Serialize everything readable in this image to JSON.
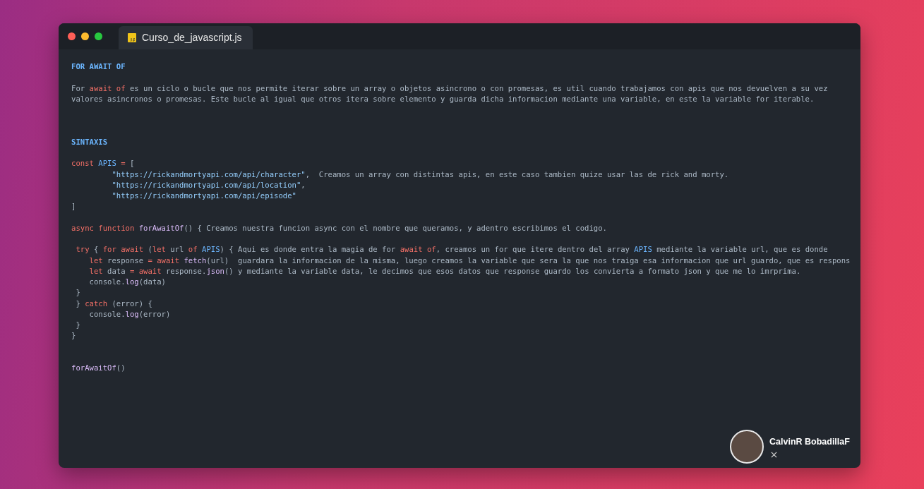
{
  "window": {
    "tabs": [
      {
        "label": "Curso_de_javascript.js",
        "selected": true
      }
    ]
  },
  "code": {
    "lines": [
      {
        "kind": "code",
        "tokens": [
          {
            "kind": "heading",
            "text": "FOR AWAIT OF"
          }
        ]
      },
      {
        "kind": "blank"
      },
      {
        "kind": "code",
        "tokens": [
          {
            "kind": "text",
            "text": "For "
          },
          {
            "kind": "keyword",
            "text": "await of"
          },
          {
            "kind": "text",
            "text": " es un ciclo o bucle que nos permite iterar sobre un array o objetos asincrono o con promesas, es util cuando trabajamos con apis que nos devuelven a su vez"
          }
        ]
      },
      {
        "kind": "code",
        "tokens": [
          {
            "kind": "text",
            "text": "valores asincronos o promesas. Este bucle al igual que otros itera sobre elemento y guarda dicha informacion mediante una variable, en este la variable for iterable."
          }
        ]
      },
      {
        "kind": "blank"
      },
      {
        "kind": "blank"
      },
      {
        "kind": "blank"
      },
      {
        "kind": "code",
        "tokens": [
          {
            "kind": "heading",
            "text": "SINTAXIS"
          }
        ]
      },
      {
        "kind": "blank"
      },
      {
        "kind": "code",
        "tokens": [
          {
            "kind": "keyword",
            "text": "const "
          },
          {
            "kind": "name",
            "text": "APIS "
          },
          {
            "kind": "keyword",
            "text": "="
          },
          {
            "kind": "text",
            "text": " ["
          }
        ]
      },
      {
        "kind": "code",
        "tokens": [
          {
            "kind": "string",
            "text": "         \"https://rickandmortyapi.com/api/character\""
          },
          {
            "kind": "text",
            "text": ",  Creamos un array con distintas apis, en este caso tambien quize usar las de rick and morty."
          }
        ]
      },
      {
        "kind": "code",
        "tokens": [
          {
            "kind": "string",
            "text": "         \"https://rickandmortyapi.com/api/location\""
          },
          {
            "kind": "text",
            "text": ","
          }
        ]
      },
      {
        "kind": "code",
        "tokens": [
          {
            "kind": "string",
            "text": "         \"https://rickandmortyapi.com/api/episode\""
          }
        ]
      },
      {
        "kind": "code",
        "tokens": [
          {
            "kind": "text",
            "text": "]"
          }
        ]
      },
      {
        "kind": "blank"
      },
      {
        "kind": "code",
        "tokens": [
          {
            "kind": "keyword",
            "text": "async function "
          },
          {
            "kind": "func",
            "text": "forAwaitOf"
          },
          {
            "kind": "text",
            "text": "() { Creamos nuestra funcion async con el nombre que queramos, y adentro escribimos el codigo."
          }
        ]
      },
      {
        "kind": "blank"
      },
      {
        "kind": "code",
        "tokens": [
          {
            "kind": "keyword",
            "text": " try"
          },
          {
            "kind": "text",
            "text": " { "
          },
          {
            "kind": "keyword",
            "text": "for await"
          },
          {
            "kind": "text",
            "text": " ("
          },
          {
            "kind": "keyword",
            "text": "let"
          },
          {
            "kind": "text",
            "text": " url "
          },
          {
            "kind": "keyword",
            "text": "of "
          },
          {
            "kind": "name",
            "text": "APIS"
          },
          {
            "kind": "text",
            "text": ") { Aqui es donde entra la magia de for "
          },
          {
            "kind": "keyword",
            "text": "await of"
          },
          {
            "kind": "text",
            "text": ", creamos un for que itere dentro del array "
          },
          {
            "kind": "name",
            "text": "APIS"
          },
          {
            "kind": "text",
            "text": " mediante la variable url, que es donde"
          }
        ]
      },
      {
        "kind": "code",
        "tokens": [
          {
            "kind": "keyword",
            "text": "    let"
          },
          {
            "kind": "text",
            "text": " response "
          },
          {
            "kind": "keyword",
            "text": "= await "
          },
          {
            "kind": "func",
            "text": "fetch"
          },
          {
            "kind": "text",
            "text": "(url)  guardara la informacion de la misma, luego creamos la variable que sera la que nos traiga esa informacion que url guardo, que es respons"
          }
        ]
      },
      {
        "kind": "code",
        "tokens": [
          {
            "kind": "keyword",
            "text": "    let"
          },
          {
            "kind": "text",
            "text": " data "
          },
          {
            "kind": "keyword",
            "text": "= await"
          },
          {
            "kind": "text",
            "text": " response."
          },
          {
            "kind": "func",
            "text": "json"
          },
          {
            "kind": "text",
            "text": "() y mediante la variable data, le decimos que esos datos que response guardo los convierta a formato json y que me lo imrprima."
          }
        ]
      },
      {
        "kind": "code",
        "tokens": [
          {
            "kind": "text",
            "text": "    console."
          },
          {
            "kind": "func",
            "text": "log"
          },
          {
            "kind": "text",
            "text": "(data)"
          }
        ]
      },
      {
        "kind": "code",
        "tokens": [
          {
            "kind": "text",
            "text": " }"
          }
        ]
      },
      {
        "kind": "code",
        "tokens": [
          {
            "kind": "text",
            "text": " } "
          },
          {
            "kind": "keyword",
            "text": "catch"
          },
          {
            "kind": "text",
            "text": " (error) {"
          }
        ]
      },
      {
        "kind": "code",
        "tokens": [
          {
            "kind": "text",
            "text": "    console."
          },
          {
            "kind": "func",
            "text": "log"
          },
          {
            "kind": "text",
            "text": "(error)"
          }
        ]
      },
      {
        "kind": "code",
        "tokens": [
          {
            "kind": "text",
            "text": " }"
          }
        ]
      },
      {
        "kind": "code",
        "tokens": [
          {
            "kind": "text",
            "text": "}"
          }
        ]
      },
      {
        "kind": "blank"
      },
      {
        "kind": "blank"
      },
      {
        "kind": "code",
        "tokens": [
          {
            "kind": "func",
            "text": "forAwaitOf"
          },
          {
            "kind": "text",
            "text": "()"
          }
        ]
      }
    ]
  },
  "author": {
    "name": "CalvinR BobadillaF"
  }
}
